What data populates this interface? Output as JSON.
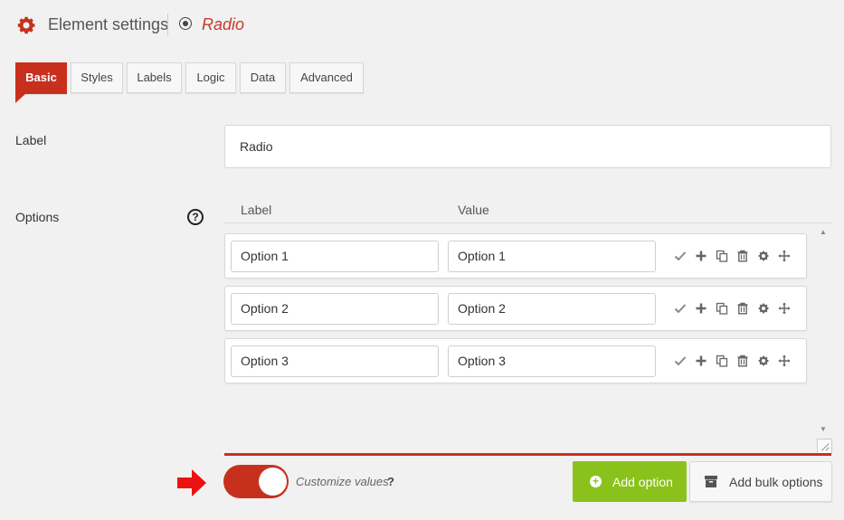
{
  "header": {
    "title": "Element settings",
    "element_type": "Radio"
  },
  "tabs": [
    {
      "label": "Basic",
      "active": true
    },
    {
      "label": "Styles",
      "active": false
    },
    {
      "label": "Labels",
      "active": false
    },
    {
      "label": "Logic",
      "active": false
    },
    {
      "label": "Data",
      "active": false
    },
    {
      "label": "Advanced",
      "active": false
    }
  ],
  "label_field": {
    "label": "Label",
    "value": "Radio"
  },
  "options_field": {
    "label": "Options",
    "help": "?",
    "columns": [
      "Label",
      "Value"
    ],
    "rows": [
      {
        "label": "Option 1",
        "value": "Option 1"
      },
      {
        "label": "Option 2",
        "value": "Option 2"
      },
      {
        "label": "Option 3",
        "value": "Option 3"
      }
    ],
    "row_actions": [
      "check-icon",
      "plus-icon",
      "copy-icon",
      "trash-icon",
      "gear-icon",
      "move-icon"
    ]
  },
  "customize": {
    "label": "Customize values",
    "help": "?",
    "enabled": true
  },
  "buttons": {
    "add_option": "Add option",
    "add_bulk": "Add bulk options"
  },
  "colors": {
    "accent": "#c8301e",
    "add_button": "#8ac21b"
  }
}
